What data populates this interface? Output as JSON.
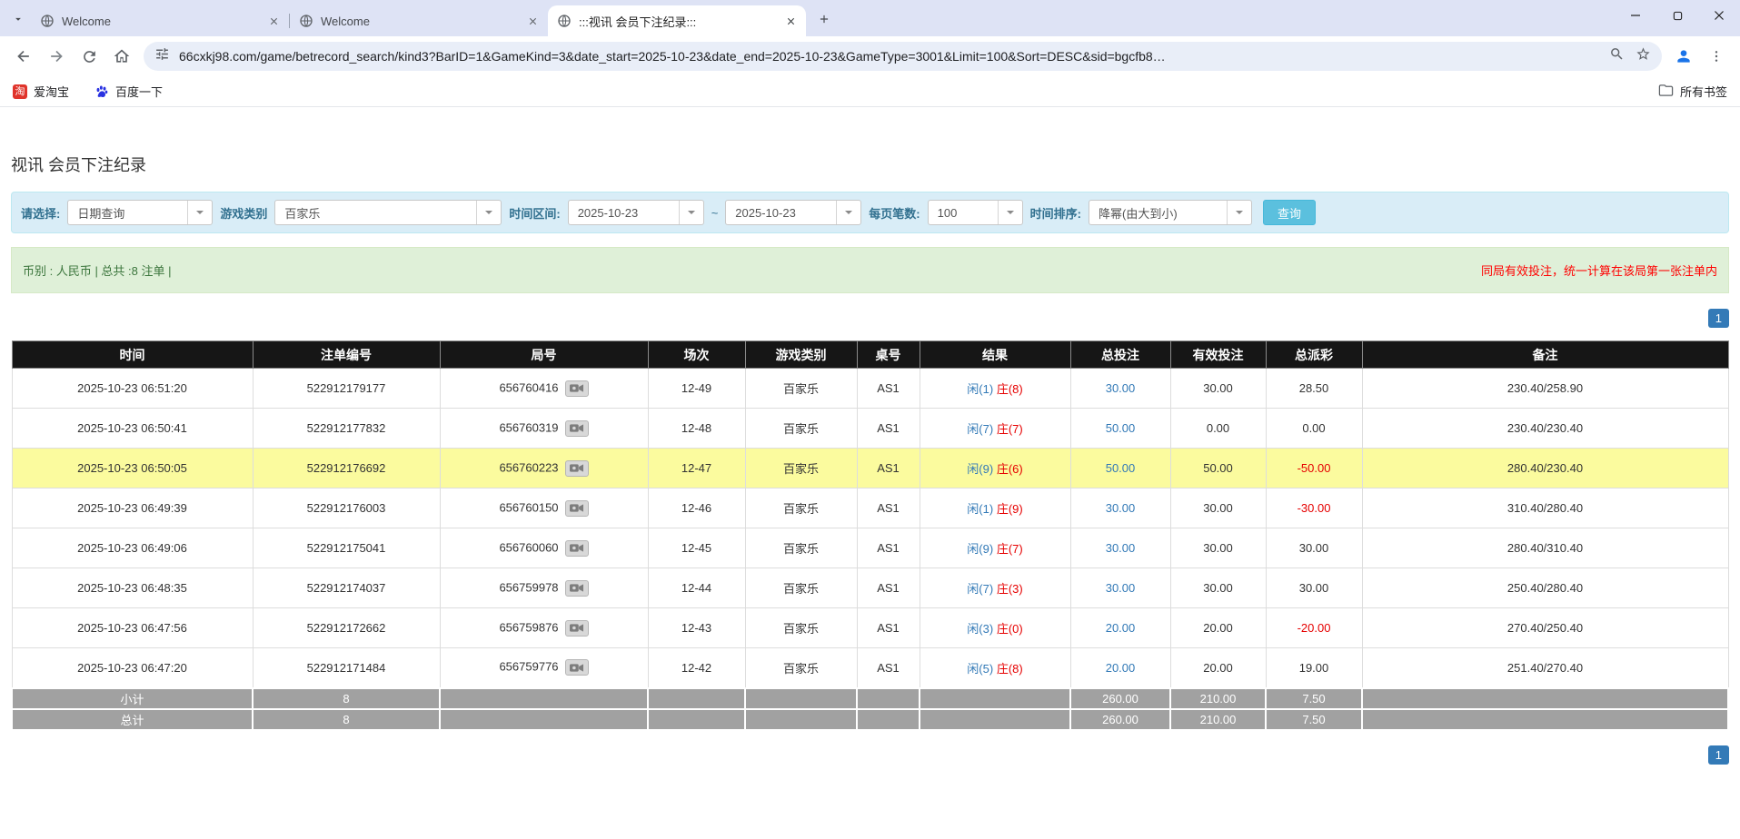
{
  "browser": {
    "tabs": [
      {
        "title": "Welcome"
      },
      {
        "title": "Welcome"
      },
      {
        "title": ":::视讯 会员下注纪录:::"
      }
    ],
    "url": "66cxkj98.com/game/betrecord_search/kind3?BarID=1&GameKind=3&date_start=2025-10-23&date_end=2025-10-23&GameType=3001&Limit=100&Sort=DESC&sid=bgcfb8…",
    "bookmarks": [
      {
        "label": "爱淘宝"
      },
      {
        "label": "百度一下"
      }
    ],
    "all_bookmarks_label": "所有书签",
    "icons": [
      "tab-search-chevron",
      "globe",
      "close-x",
      "new-tab-plus",
      "minimize",
      "maximize",
      "close-window",
      "back-arrow",
      "forward-arrow",
      "refresh",
      "home",
      "site-info-tune",
      "zoom-magnifier",
      "bookmark-star",
      "profile-person",
      "kebab-menu",
      "taobao",
      "baidu-paw",
      "folder"
    ]
  },
  "page": {
    "title": "视讯 会员下注纪录",
    "filters": {
      "query_type_label": "请选择:",
      "query_type_value": "日期查询",
      "game_type_label": "游戏类别",
      "game_type_value": "百家乐",
      "date_range_label": "时间区间:",
      "date_start": "2025-10-23",
      "date_tilde": "~",
      "date_end": "2025-10-23",
      "page_size_label": "每页笔数:",
      "page_size_value": "100",
      "sort_label": "时间排序:",
      "sort_value": "降幂(由大到小)",
      "search_button": "查询"
    },
    "summary_bar": {
      "left": "币别 : 人民币 | 总共 :8 注单 |",
      "right": "同局有效投注，统一计算在该局第一张注单内"
    },
    "pagination": {
      "page": "1"
    },
    "table": {
      "headers": [
        "时间",
        "注单编号",
        "局号",
        "场次",
        "游戏类别",
        "桌号",
        "结果",
        "总投注",
        "有效投注",
        "总派彩",
        "备注"
      ],
      "rows": [
        {
          "time": "2025-10-23 06:51:20",
          "bet_id": "522912179177",
          "round_id": "656760416",
          "session": "12-49",
          "game": "百家乐",
          "table_no": "AS1",
          "result_player": "闲(1)",
          "result_banker": "庄(8)",
          "total_bet": "30.00",
          "valid_bet": "30.00",
          "payout": "28.50",
          "remark": "230.40/258.90",
          "highlighted": false
        },
        {
          "time": "2025-10-23 06:50:41",
          "bet_id": "522912177832",
          "round_id": "656760319",
          "session": "12-48",
          "game": "百家乐",
          "table_no": "AS1",
          "result_player": "闲(7)",
          "result_banker": "庄(7)",
          "total_bet": "50.00",
          "valid_bet": "0.00",
          "payout": "0.00",
          "remark": "230.40/230.40",
          "highlighted": false
        },
        {
          "time": "2025-10-23 06:50:05",
          "bet_id": "522912176692",
          "round_id": "656760223",
          "session": "12-47",
          "game": "百家乐",
          "table_no": "AS1",
          "result_player": "闲(9)",
          "result_banker": "庄(6)",
          "total_bet": "50.00",
          "valid_bet": "50.00",
          "payout": "-50.00",
          "remark": "280.40/230.40",
          "highlighted": true
        },
        {
          "time": "2025-10-23 06:49:39",
          "bet_id": "522912176003",
          "round_id": "656760150",
          "session": "12-46",
          "game": "百家乐",
          "table_no": "AS1",
          "result_player": "闲(1)",
          "result_banker": "庄(9)",
          "total_bet": "30.00",
          "valid_bet": "30.00",
          "payout": "-30.00",
          "remark": "310.40/280.40",
          "highlighted": false
        },
        {
          "time": "2025-10-23 06:49:06",
          "bet_id": "522912175041",
          "round_id": "656760060",
          "session": "12-45",
          "game": "百家乐",
          "table_no": "AS1",
          "result_player": "闲(9)",
          "result_banker": "庄(7)",
          "total_bet": "30.00",
          "valid_bet": "30.00",
          "payout": "30.00",
          "remark": "280.40/310.40",
          "highlighted": false
        },
        {
          "time": "2025-10-23 06:48:35",
          "bet_id": "522912174037",
          "round_id": "656759978",
          "session": "12-44",
          "game": "百家乐",
          "table_no": "AS1",
          "result_player": "闲(7)",
          "result_banker": "庄(3)",
          "total_bet": "30.00",
          "valid_bet": "30.00",
          "payout": "30.00",
          "remark": "250.40/280.40",
          "highlighted": false
        },
        {
          "time": "2025-10-23 06:47:56",
          "bet_id": "522912172662",
          "round_id": "656759876",
          "session": "12-43",
          "game": "百家乐",
          "table_no": "AS1",
          "result_player": "闲(3)",
          "result_banker": "庄(0)",
          "total_bet": "20.00",
          "valid_bet": "20.00",
          "payout": "-20.00",
          "remark": "270.40/250.40",
          "highlighted": false
        },
        {
          "time": "2025-10-23 06:47:20",
          "bet_id": "522912171484",
          "round_id": "656759776",
          "session": "12-42",
          "game": "百家乐",
          "table_no": "AS1",
          "result_player": "闲(5)",
          "result_banker": "庄(8)",
          "total_bet": "20.00",
          "valid_bet": "20.00",
          "payout": "19.00",
          "remark": "251.40/270.40",
          "highlighted": false
        }
      ],
      "subtotal": {
        "label": "小计",
        "count": "8",
        "total_bet": "260.00",
        "valid_bet": "210.00",
        "payout": "7.50"
      },
      "total": {
        "label": "总计",
        "count": "8",
        "total_bet": "260.00",
        "valid_bet": "210.00",
        "payout": "7.50"
      }
    },
    "colors": {
      "accent_blue": "#337ab7",
      "negative_red": "#e60000",
      "result_player_blue": "#337ab7",
      "result_banker_red": "#e60000",
      "highlight_yellow": "#fbfb9e",
      "filter_bg": "#d9edf7",
      "summary_bg": "#dff0d8",
      "search_button_bg": "#5bc0de"
    }
  }
}
